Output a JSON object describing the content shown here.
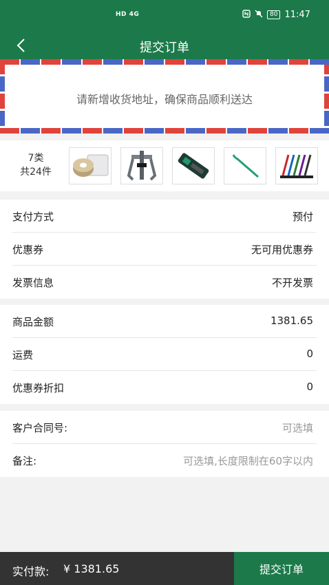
{
  "status_bar": {
    "network": "HD 4G",
    "battery": "80",
    "time": "11:47"
  },
  "header": {
    "title": "提交订单"
  },
  "address": {
    "prompt": "请新增收货地址，确保商品顺利送达"
  },
  "goods": {
    "category_count": "7类",
    "item_count": "共24件",
    "thumbnails": [
      "packing-tape-icon",
      "gear-puller-icon",
      "tool-case-icon",
      "pry-bar-icon",
      "screwdriver-set-icon"
    ]
  },
  "order_info": {
    "payment_label": "支付方式",
    "payment_value": "预付",
    "coupon_label": "优惠券",
    "coupon_value": "无可用优惠券",
    "invoice_label": "发票信息",
    "invoice_value": "不开发票"
  },
  "amounts": {
    "goods_amount_label": "商品金额",
    "goods_amount_value": "1381.65",
    "shipping_label": "运费",
    "shipping_value": "0",
    "coupon_discount_label": "优惠券折扣",
    "coupon_discount_value": "0"
  },
  "extra": {
    "contract_label": "客户合同号:",
    "contract_placeholder": "可选填",
    "remark_label": "备注:",
    "remark_placeholder": "可选填,长度限制在60字以内"
  },
  "footer": {
    "pay_label": "实付款:",
    "pay_amount": "¥ 1381.65",
    "submit_label": "提交订单"
  },
  "colors": {
    "brand": "#1c7a4a",
    "footer_bg": "#333333",
    "stripe_red": "#e0433b",
    "stripe_blue": "#4a67c6"
  }
}
